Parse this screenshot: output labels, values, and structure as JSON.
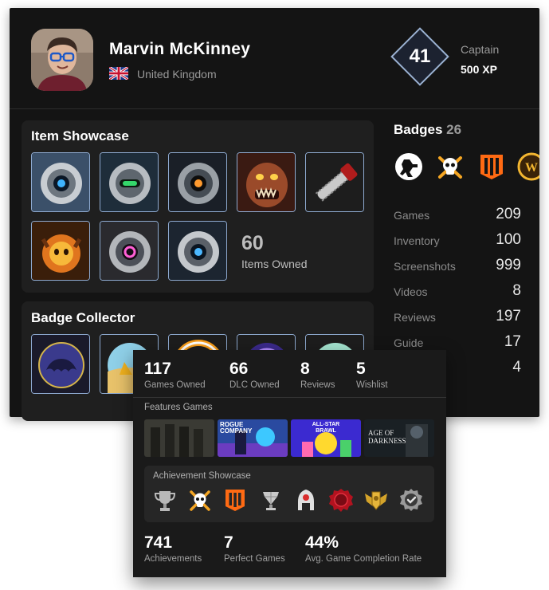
{
  "profile": {
    "name": "Marvin McKinney",
    "country": "United Kingdom",
    "level": "41",
    "rank": "Captain",
    "xp": "500 XP"
  },
  "item_showcase": {
    "title": "Item Showcase",
    "items_count": "60",
    "items_label": "Items Owned",
    "items": [
      "portal-core-blue",
      "portal-core-green",
      "portal-core-orange",
      "zombie-creature",
      "chainsaw",
      "fire-creature",
      "portal-core-pink",
      "portal-core-blue-2"
    ]
  },
  "badge_collector": {
    "title": "Badge Collector",
    "badges": [
      "kraken-badge",
      "beach-badge",
      "overwatch-badge",
      "purple-emblem-badge",
      "mint-badge"
    ]
  },
  "badges": {
    "title": "Badges",
    "count": "26",
    "icons": [
      "soldier-icon",
      "skull-crossbones-icon",
      "black-ops-icon",
      "warcraft-icon"
    ]
  },
  "stats": [
    {
      "label": "Games",
      "value": "209"
    },
    {
      "label": "Inventory",
      "value": "100"
    },
    {
      "label": "Screenshots",
      "value": "999"
    },
    {
      "label": "Videos",
      "value": "8"
    },
    {
      "label": "Reviews",
      "value": "197"
    },
    {
      "label": "Guide",
      "value": "17"
    },
    {
      "label": "",
      "value": "4"
    }
  ],
  "overlay": {
    "stats": [
      {
        "value": "117",
        "label": "Games Owned"
      },
      {
        "value": "66",
        "label": "DLC Owned"
      },
      {
        "value": "8",
        "label": "Reviews"
      },
      {
        "value": "5",
        "label": "Wishlist"
      }
    ],
    "features_title": "Features Games",
    "games": [
      {
        "title": ""
      },
      {
        "title": "ROGUE COMPANY"
      },
      {
        "title": "ALL-STAR BRAWL"
      },
      {
        "title": "AGE OF DARKNESS"
      }
    ],
    "achievement_title": "Achievement Showcase",
    "achievement_icons": [
      "trophy-icon",
      "skull-icon",
      "black-ops-icon",
      "diamond-trophy-icon",
      "robot-icon",
      "red-orb-icon",
      "winged-crest-icon",
      "check-badge-icon"
    ],
    "totals": [
      {
        "value": "741",
        "label": "Achievements"
      },
      {
        "value": "7",
        "label": "Perfect Games"
      },
      {
        "value": "44%",
        "label": "Avg. Game Completion Rate"
      }
    ]
  }
}
